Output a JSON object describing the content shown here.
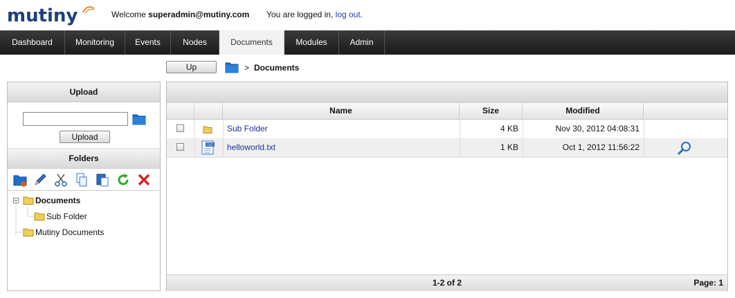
{
  "header": {
    "logo_text": "mutiny",
    "welcome_prefix": "Welcome",
    "username": "superadmin@mutiny.com",
    "logged_in_text": "You are logged in,",
    "logout_label": "log out."
  },
  "nav": {
    "tabs": [
      {
        "label": "Dashboard"
      },
      {
        "label": "Monitoring"
      },
      {
        "label": "Events"
      },
      {
        "label": "Nodes"
      },
      {
        "label": "Documents",
        "active": true
      },
      {
        "label": "Modules"
      },
      {
        "label": "Admin"
      }
    ]
  },
  "breadcrumb": {
    "up_label": "Up",
    "separator": ">",
    "current": "Documents"
  },
  "upload": {
    "title": "Upload",
    "file_value": "",
    "button_label": "Upload"
  },
  "folders": {
    "title": "Folders",
    "toolbar": [
      "new-folder-icon",
      "rename-pencil-icon",
      "cut-scissors-icon",
      "copy-icon",
      "paste-icon",
      "refresh-icon",
      "delete-icon"
    ],
    "tree": [
      {
        "label": "Documents",
        "expanded": true,
        "bold": true
      },
      {
        "label": "Sub Folder"
      },
      {
        "label": "Mutiny Documents"
      }
    ]
  },
  "grid": {
    "columns": {
      "name": "Name",
      "size": "Size",
      "modified": "Modified"
    },
    "rows": [
      {
        "name": "Sub Folder",
        "size": "4 KB",
        "modified": "Nov 30, 2012 04:08:31",
        "icon": "folder-icon",
        "preview": false
      },
      {
        "name": "helloworld.txt",
        "size": "1 KB",
        "modified": "Oct 1, 2012 11:56:22",
        "icon": "text-file-icon",
        "preview": true
      }
    ],
    "pager": "1-2 of 2",
    "page": "Page: 1"
  },
  "colors": {
    "nav_bg": "#262626",
    "link": "#1f2f9a",
    "logo": "#1d3f7c",
    "folder_blue": "#1a6fc9",
    "folder_yellow": "#f3cf57"
  }
}
